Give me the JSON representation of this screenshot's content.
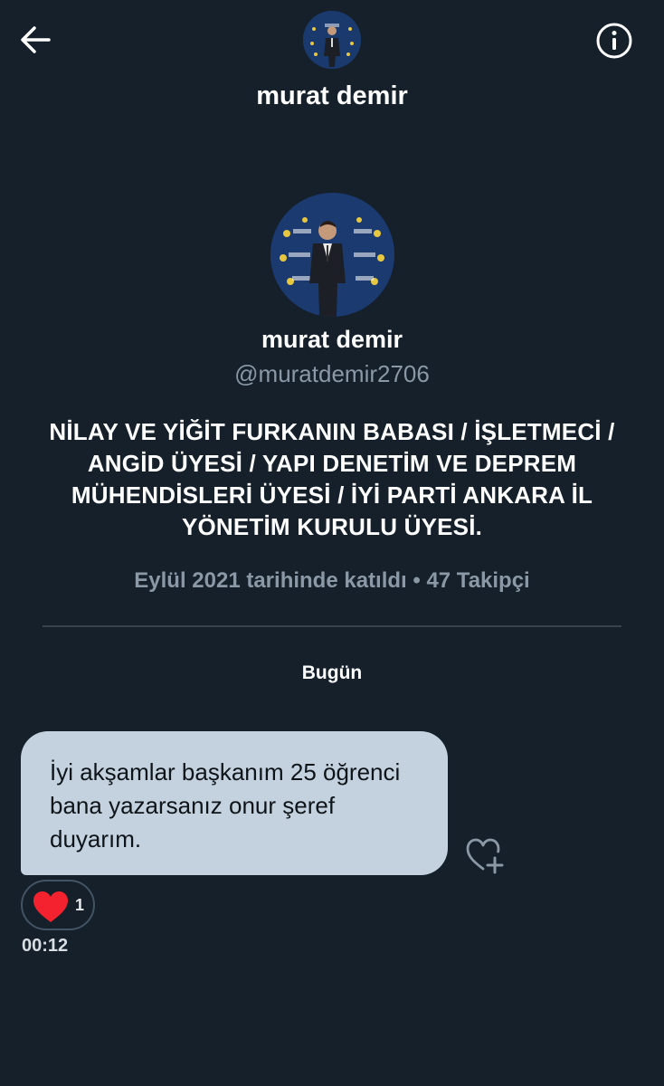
{
  "header": {
    "title": "murat demir",
    "back_icon": "arrow-left-icon",
    "info_icon": "info-circle-icon"
  },
  "profile": {
    "name": "murat demir",
    "handle": "@muratdemir2706",
    "bio": "NİLAY VE YİĞİT FURKANIN BABASI / İŞLETMECİ / ANGİD ÜYESİ / YAPI DENETİM VE DEPREM MÜHENDİSLERİ ÜYESİ / İYİ PARTİ ANKARA İL YÖNETİM KURULU ÜYESİ.",
    "meta": "Eylül 2021 tarihinde katıldı • 47 Takipçi"
  },
  "conversation": {
    "day_label": "Bugün",
    "messages": [
      {
        "text": "İyi akşamlar başkanım 25 öğrenci bana yazarsanız onur şeref duyarım.",
        "reaction_count": "1",
        "time": "00:12"
      }
    ]
  },
  "colors": {
    "background": "#15202b",
    "secondary_text": "#8b98a5",
    "bubble": "#c4d2df",
    "heart": "#f4212e"
  }
}
